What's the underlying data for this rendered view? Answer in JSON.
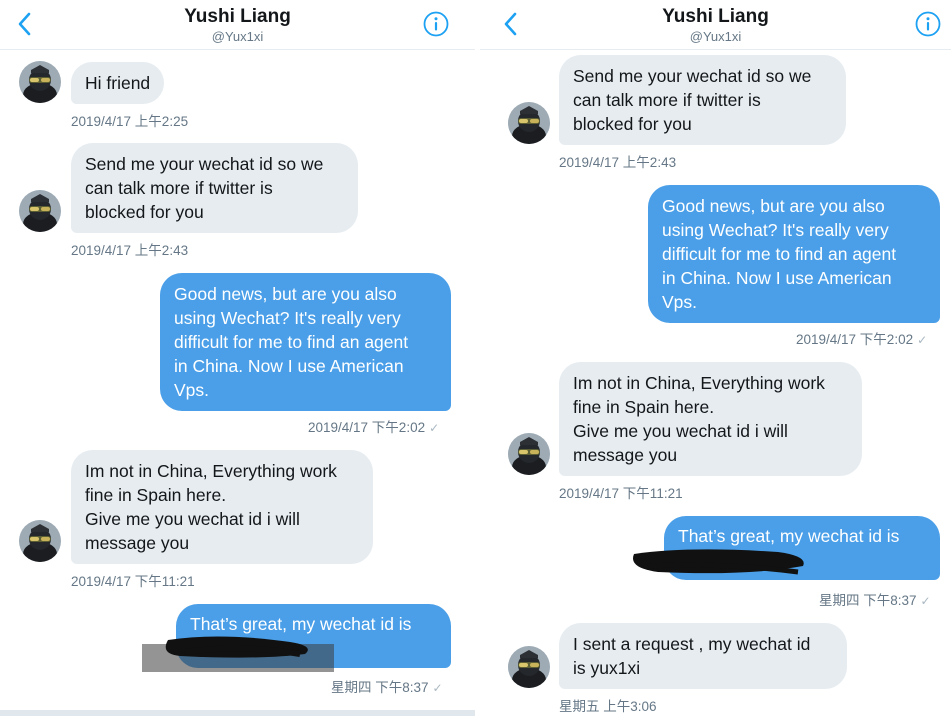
{
  "header": {
    "title": "Yushi Liang",
    "handle": "@Yux1xi"
  },
  "colors": {
    "outgoing_bubble": "#4a9fe8",
    "incoming_bubble": "#e6ecf0",
    "accent": "#1da1f2",
    "meta_text": "#657786"
  },
  "icons": {
    "back": "chevron-left-icon",
    "info": "info-circle-icon",
    "read": "checkmark-icon",
    "avatar": "avatar-icon"
  },
  "left": {
    "messages": [
      {
        "text": "Hi friend",
        "time": "2019/4/17 上午2:25",
        "dir": "in"
      },
      {
        "text": "Send me your wechat id so we\ncan talk more if twitter is\nblocked for you",
        "time": "2019/4/17 上午2:43",
        "dir": "in"
      },
      {
        "text": "Good news, but are you also\nusing Wechat? It's really very\ndifficult for me to find an agent\nin China. Now I use American\nVps.",
        "time": "2019/4/17 下午2:02",
        "dir": "out"
      },
      {
        "text": "Im not in China, Everything work\nfine in Spain here.\nGive me you wechat id i will\nmessage you",
        "time": "2019/4/17 下午11:21",
        "dir": "in"
      },
      {
        "text": "That’s great, my wechat id is",
        "time": "星期四 下午8:37",
        "dir": "out"
      }
    ]
  },
  "right": {
    "messages": [
      {
        "text": "Send me your wechat id so we\ncan talk more if twitter is\nblocked for you",
        "time": "2019/4/17 上午2:43",
        "dir": "in"
      },
      {
        "text": "Good news, but are you also\nusing Wechat? It's really very\ndifficult for me to find an agent\nin China. Now I use American\nVps.",
        "time": "2019/4/17 下午2:02",
        "dir": "out"
      },
      {
        "text": "Im not in China, Everything work\nfine in Spain here.\nGive me you wechat id i will\nmessage you",
        "time": "2019/4/17 下午11:21",
        "dir": "in"
      },
      {
        "text": "That’s great, my wechat id is",
        "time": "星期四 下午8:37",
        "dir": "out"
      },
      {
        "text": "I sent a request , my wechat id\nis yux1xi",
        "time": "星期五 上午3:06",
        "dir": "in"
      }
    ]
  }
}
